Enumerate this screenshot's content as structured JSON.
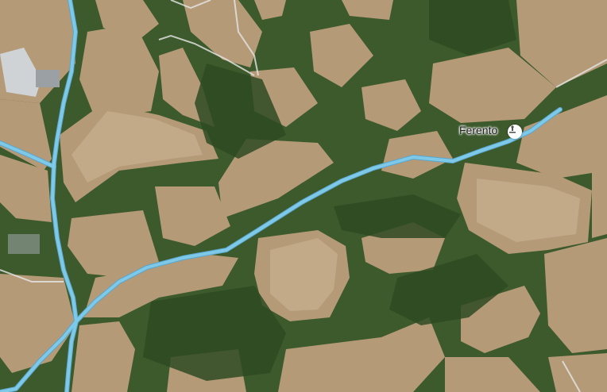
{
  "map": {
    "type": "satellite",
    "colors": {
      "forest": "#3d5a2c",
      "forest_dark": "#2e4a22",
      "field": "#b59a78",
      "field_light": "#c8b08e",
      "road": "#7ec8e8",
      "road_outline": "#5aa6cc",
      "building": "#cfd3d6",
      "minor_road": "#e6e6e6"
    },
    "places": [
      {
        "name": "Ferento",
        "icon": "landmark-icon"
      }
    ]
  }
}
